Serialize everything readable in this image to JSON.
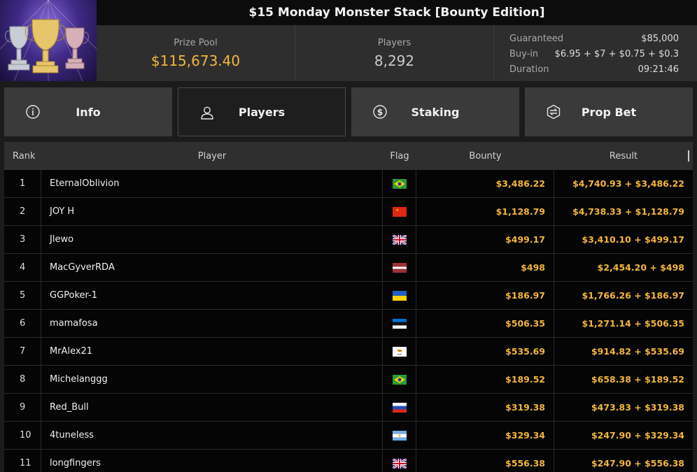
{
  "tournament": {
    "title": "$15 Monday Monster Stack [Bounty Edition]",
    "thumbnail_icon": "trophies-icon"
  },
  "stats": {
    "prize_pool_label": "Prize Pool",
    "prize_pool_value": "$115,673.40",
    "players_label": "Players",
    "players_value": "8,292",
    "details": [
      {
        "label": "Guaranteed",
        "value": "$85,000"
      },
      {
        "label": "Buy-in",
        "value": "$6.95 + $7 + $0.75 + $0.3"
      },
      {
        "label": "Duration",
        "value": "09:21:46"
      }
    ]
  },
  "tabs": [
    {
      "label": "Info",
      "icon": "info-icon",
      "active": false
    },
    {
      "label": "Players",
      "icon": "user-icon",
      "active": true
    },
    {
      "label": "Staking",
      "icon": "staking-coin-icon",
      "active": false
    },
    {
      "label": "Prop Bet",
      "icon": "prop-bet-icon",
      "active": false
    }
  ],
  "table": {
    "headers": {
      "rank": "Rank",
      "player": "Player",
      "flag": "Flag",
      "bounty": "Bounty",
      "result": "Result"
    },
    "rows": [
      {
        "rank": "1",
        "player": "EternalOblivion",
        "flag": "brazil-flag-icon",
        "bounty": "$3,486.22",
        "result": "$4,740.93 + $3,486.22"
      },
      {
        "rank": "2",
        "player": "JOY H",
        "flag": "china-flag-icon",
        "bounty": "$1,128.79",
        "result": "$4,738.33 + $1,128.79"
      },
      {
        "rank": "3",
        "player": "Jlewo",
        "flag": "uk-flag-icon",
        "bounty": "$499.17",
        "result": "$3,410.10 + $499.17"
      },
      {
        "rank": "4",
        "player": "MacGyverRDA",
        "flag": "latvia-flag-icon",
        "bounty": "$498",
        "result": "$2,454.20 + $498"
      },
      {
        "rank": "5",
        "player": "GGPoker-1",
        "flag": "ukraine-flag-icon",
        "bounty": "$186.97",
        "result": "$1,766.26 + $186.97"
      },
      {
        "rank": "6",
        "player": "mamafosa",
        "flag": "estonia-flag-icon",
        "bounty": "$506.35",
        "result": "$1,271.14 + $506.35"
      },
      {
        "rank": "7",
        "player": "MrAlex21",
        "flag": "cyprus-flag-icon",
        "bounty": "$535.69",
        "result": "$914.82 + $535.69"
      },
      {
        "rank": "8",
        "player": "Michelanggg",
        "flag": "brazil-flag-icon",
        "bounty": "$189.52",
        "result": "$658.38 + $189.52"
      },
      {
        "rank": "9",
        "player": "Red_Bull",
        "flag": "russia-flag-icon",
        "bounty": "$319.38",
        "result": "$473.83 + $319.38"
      },
      {
        "rank": "10",
        "player": "4tuneless",
        "flag": "argentina-flag-icon",
        "bounty": "$329.34",
        "result": "$247.90 + $329.34"
      },
      {
        "rank": "11",
        "player": "longfingers",
        "flag": "uk-flag-icon",
        "bounty": "$556.38",
        "result": "$247.90 + $556.38"
      }
    ]
  },
  "colors": {
    "accent_gold": "#f3b63c",
    "tab_bg": "#3a3a3a",
    "row_bg": "#050505"
  }
}
